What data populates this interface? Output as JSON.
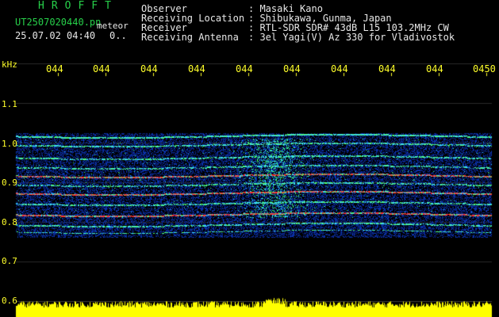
{
  "app": {
    "title": "HROFFT",
    "filename": "UT2507020440.pn",
    "suffix": "meteor",
    "datetime": "25.07.02 04:40",
    "count": "0.."
  },
  "info": {
    "labels": [
      "Observer",
      "Receiving Location",
      "Receiver",
      "Receiving Antenna"
    ],
    "values": [
      ": Masaki Kano",
      ": Shibukawa, Gunma, Japan",
      ": RTL-SDR SDR# 43dB L15 103.2MHz CW",
      ": 3el Yagi(V) Az 330 for Vladivostok"
    ]
  },
  "axis": {
    "y_unit": "kHz",
    "y_ticks": [
      "1.1",
      "1.0",
      "0.9",
      "0.8",
      "0.7",
      "0.6"
    ],
    "x_ticks": [
      "044",
      "044",
      "044",
      "044",
      "044",
      "044",
      "044",
      "044",
      "044",
      "0450"
    ]
  },
  "colors": {
    "background": "#000000",
    "text_green": "#27d04a",
    "text_yellow": "#ffff2a",
    "text_white": "#e8e8e8",
    "band_blue": "#1030c0",
    "signal_cyan": "#30d0ff",
    "signal_green": "#40ff60",
    "signal_red": "#ff3030"
  }
}
